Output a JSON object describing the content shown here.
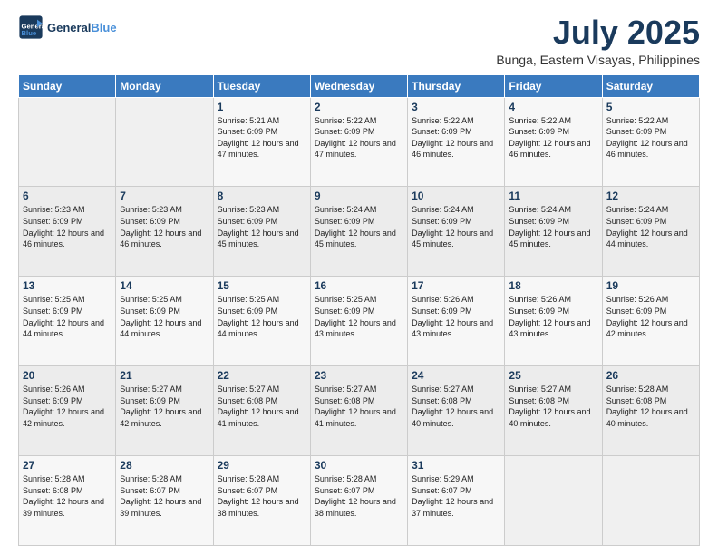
{
  "header": {
    "logo_line1": "General",
    "logo_line2": "Blue",
    "title": "July 2025",
    "subtitle": "Bunga, Eastern Visayas, Philippines"
  },
  "weekdays": [
    "Sunday",
    "Monday",
    "Tuesday",
    "Wednesday",
    "Thursday",
    "Friday",
    "Saturday"
  ],
  "weeks": [
    [
      {
        "day": "",
        "info": ""
      },
      {
        "day": "",
        "info": ""
      },
      {
        "day": "1",
        "info": "Sunrise: 5:21 AM\nSunset: 6:09 PM\nDaylight: 12 hours and 47 minutes."
      },
      {
        "day": "2",
        "info": "Sunrise: 5:22 AM\nSunset: 6:09 PM\nDaylight: 12 hours and 47 minutes."
      },
      {
        "day": "3",
        "info": "Sunrise: 5:22 AM\nSunset: 6:09 PM\nDaylight: 12 hours and 46 minutes."
      },
      {
        "day": "4",
        "info": "Sunrise: 5:22 AM\nSunset: 6:09 PM\nDaylight: 12 hours and 46 minutes."
      },
      {
        "day": "5",
        "info": "Sunrise: 5:22 AM\nSunset: 6:09 PM\nDaylight: 12 hours and 46 minutes."
      }
    ],
    [
      {
        "day": "6",
        "info": "Sunrise: 5:23 AM\nSunset: 6:09 PM\nDaylight: 12 hours and 46 minutes."
      },
      {
        "day": "7",
        "info": "Sunrise: 5:23 AM\nSunset: 6:09 PM\nDaylight: 12 hours and 46 minutes."
      },
      {
        "day": "8",
        "info": "Sunrise: 5:23 AM\nSunset: 6:09 PM\nDaylight: 12 hours and 45 minutes."
      },
      {
        "day": "9",
        "info": "Sunrise: 5:24 AM\nSunset: 6:09 PM\nDaylight: 12 hours and 45 minutes."
      },
      {
        "day": "10",
        "info": "Sunrise: 5:24 AM\nSunset: 6:09 PM\nDaylight: 12 hours and 45 minutes."
      },
      {
        "day": "11",
        "info": "Sunrise: 5:24 AM\nSunset: 6:09 PM\nDaylight: 12 hours and 45 minutes."
      },
      {
        "day": "12",
        "info": "Sunrise: 5:24 AM\nSunset: 6:09 PM\nDaylight: 12 hours and 44 minutes."
      }
    ],
    [
      {
        "day": "13",
        "info": "Sunrise: 5:25 AM\nSunset: 6:09 PM\nDaylight: 12 hours and 44 minutes."
      },
      {
        "day": "14",
        "info": "Sunrise: 5:25 AM\nSunset: 6:09 PM\nDaylight: 12 hours and 44 minutes."
      },
      {
        "day": "15",
        "info": "Sunrise: 5:25 AM\nSunset: 6:09 PM\nDaylight: 12 hours and 44 minutes."
      },
      {
        "day": "16",
        "info": "Sunrise: 5:25 AM\nSunset: 6:09 PM\nDaylight: 12 hours and 43 minutes."
      },
      {
        "day": "17",
        "info": "Sunrise: 5:26 AM\nSunset: 6:09 PM\nDaylight: 12 hours and 43 minutes."
      },
      {
        "day": "18",
        "info": "Sunrise: 5:26 AM\nSunset: 6:09 PM\nDaylight: 12 hours and 43 minutes."
      },
      {
        "day": "19",
        "info": "Sunrise: 5:26 AM\nSunset: 6:09 PM\nDaylight: 12 hours and 42 minutes."
      }
    ],
    [
      {
        "day": "20",
        "info": "Sunrise: 5:26 AM\nSunset: 6:09 PM\nDaylight: 12 hours and 42 minutes."
      },
      {
        "day": "21",
        "info": "Sunrise: 5:27 AM\nSunset: 6:09 PM\nDaylight: 12 hours and 42 minutes."
      },
      {
        "day": "22",
        "info": "Sunrise: 5:27 AM\nSunset: 6:08 PM\nDaylight: 12 hours and 41 minutes."
      },
      {
        "day": "23",
        "info": "Sunrise: 5:27 AM\nSunset: 6:08 PM\nDaylight: 12 hours and 41 minutes."
      },
      {
        "day": "24",
        "info": "Sunrise: 5:27 AM\nSunset: 6:08 PM\nDaylight: 12 hours and 40 minutes."
      },
      {
        "day": "25",
        "info": "Sunrise: 5:27 AM\nSunset: 6:08 PM\nDaylight: 12 hours and 40 minutes."
      },
      {
        "day": "26",
        "info": "Sunrise: 5:28 AM\nSunset: 6:08 PM\nDaylight: 12 hours and 40 minutes."
      }
    ],
    [
      {
        "day": "27",
        "info": "Sunrise: 5:28 AM\nSunset: 6:08 PM\nDaylight: 12 hours and 39 minutes."
      },
      {
        "day": "28",
        "info": "Sunrise: 5:28 AM\nSunset: 6:07 PM\nDaylight: 12 hours and 39 minutes."
      },
      {
        "day": "29",
        "info": "Sunrise: 5:28 AM\nSunset: 6:07 PM\nDaylight: 12 hours and 38 minutes."
      },
      {
        "day": "30",
        "info": "Sunrise: 5:28 AM\nSunset: 6:07 PM\nDaylight: 12 hours and 38 minutes."
      },
      {
        "day": "31",
        "info": "Sunrise: 5:29 AM\nSunset: 6:07 PM\nDaylight: 12 hours and 37 minutes."
      },
      {
        "day": "",
        "info": ""
      },
      {
        "day": "",
        "info": ""
      }
    ]
  ]
}
